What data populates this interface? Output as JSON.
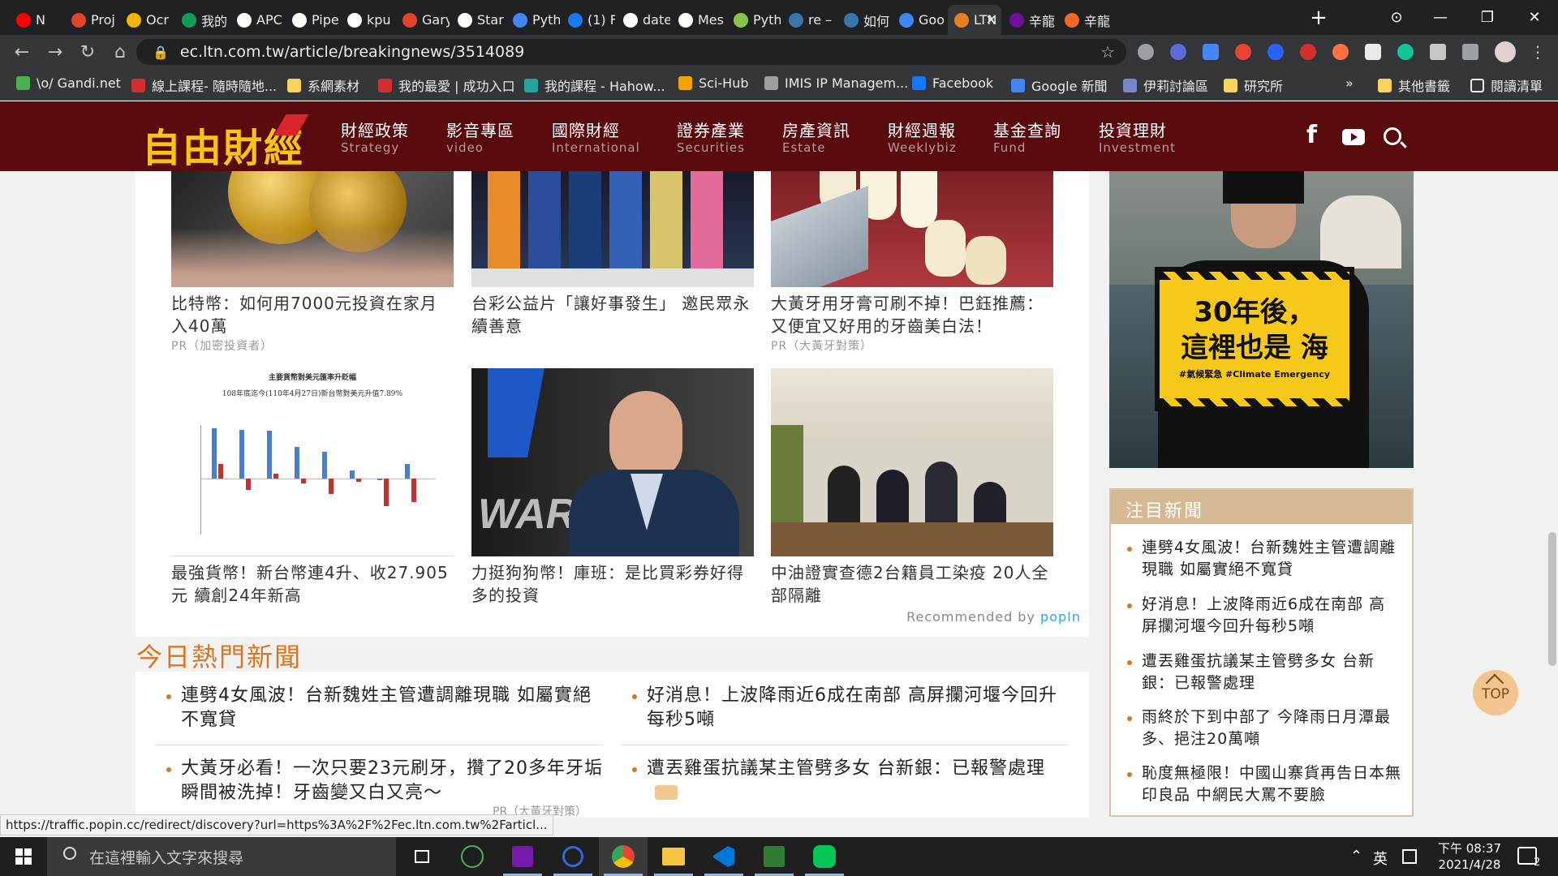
{
  "browser": {
    "tabs": [
      {
        "label": "N",
        "color": "#ff0000"
      },
      {
        "label": "Proj",
        "color": "#e24329"
      },
      {
        "label": "Ocr",
        "color": "#f4b400"
      },
      {
        "label": "我的",
        "color": "#0f9d58"
      },
      {
        "label": "APC",
        "color": "#ffffff"
      },
      {
        "label": "Pipe",
        "color": "#ffffff"
      },
      {
        "label": "kpu",
        "color": "#ffffff"
      },
      {
        "label": "Gary",
        "color": "#e24329"
      },
      {
        "label": "Star",
        "color": "#ffffff"
      },
      {
        "label": "Pyth",
        "color": "#4285f4"
      },
      {
        "label": "(1) F",
        "color": "#1877f2"
      },
      {
        "label": "date",
        "color": "#ffffff"
      },
      {
        "label": "Mes",
        "color": "#ffffff"
      },
      {
        "label": "Pyth",
        "color": "#8bc34a"
      },
      {
        "label": "re –",
        "color": "#3776ab"
      },
      {
        "label": "如何",
        "color": "#3776ab"
      },
      {
        "label": "Goo",
        "color": "#4285f4"
      },
      {
        "label": "LTN i",
        "color": "#e67e22"
      },
      {
        "label": "辛龍",
        "color": "#720e9e"
      },
      {
        "label": "辛龍",
        "color": "#f26722"
      }
    ],
    "url": "ec.ltn.com.tw/article/breakingnews/3514089",
    "bookmarks": [
      {
        "label": "\\o/ Gandi.net",
        "color": "#4caf50"
      },
      {
        "label": "線上課程- 隨時隨地...",
        "color": "#d32f2f"
      },
      {
        "label": "系網素材",
        "color": "#f9d35c"
      },
      {
        "label": "我的最愛 | 成功入口",
        "color": "#d32f2f"
      },
      {
        "label": "我的課程 - Hahow...",
        "color": "#26a69a"
      },
      {
        "label": "Sci-Hub",
        "color": "#f4a300"
      },
      {
        "label": "IMIS IP Managem...",
        "color": "#9e9e9e"
      },
      {
        "label": "Facebook",
        "color": "#1877f2"
      },
      {
        "label": "Google 新聞",
        "color": "#4285f4"
      },
      {
        "label": "伊莉討論區",
        "color": "#7986cb"
      },
      {
        "label": "研究所",
        "color": "#f9d35c"
      }
    ],
    "other_bookmarks": "其他書籤",
    "reading_list": "閱讀清單"
  },
  "site": {
    "logo": "自由財經",
    "nav": [
      {
        "zh": "財經政策",
        "en": "Strategy"
      },
      {
        "zh": "影音專區",
        "en": "video"
      },
      {
        "zh": "國際財經",
        "en": "International"
      },
      {
        "zh": "證券產業",
        "en": "Securities"
      },
      {
        "zh": "房產資訊",
        "en": "Estate"
      },
      {
        "zh": "財經週報",
        "en": "Weeklybiz"
      },
      {
        "zh": "基金查詢",
        "en": "Fund"
      },
      {
        "zh": "投資理財",
        "en": "Investment"
      }
    ]
  },
  "recommend": {
    "cards": [
      {
        "title": "比特幣：如何用7000元投資在家月入40萬",
        "source": "PR（加密投資者）"
      },
      {
        "title": "台彩公益片「讓好事發生」 邀民眾永續善意",
        "source": ""
      },
      {
        "title": "大黃牙用牙膏可刷不掉！巴鈺推薦：又便宜又好用的牙齒美白法！",
        "source": "PR（大黃牙對策）"
      },
      {
        "title": "最強貨幣！新台幣連4升、收27.905元 續創24年新高",
        "source": "",
        "chart_caption": "主要貨幣對美元匯率升貶幅",
        "chart_sub": "108年底迄今(110年4月27日)新台幣對美元升值7.89%"
      },
      {
        "title": "力挺狗狗幣！庫班：是比買彩券好得多的投資",
        "source": ""
      },
      {
        "title": "中油證實查德2台籍員工染疫 20人全部隔離",
        "source": ""
      }
    ],
    "recommended_by": "Recommended by",
    "brand": "popIn"
  },
  "hot_news": {
    "heading": "今日熱門新聞",
    "items": [
      {
        "title": "連劈4女風波！台新魏姓主管遭調離現職 如屬實絕不寬貸",
        "source": ""
      },
      {
        "title": "好消息！上波降雨近6成在南部 高屏攔河堰今回升每秒5噸",
        "source": ""
      },
      {
        "title": "大黃牙必看！一次只要23元刷牙，攢了20多年牙垢瞬間被洗掉！牙齒變又白又亮～",
        "source": "PR（大黃牙對策）"
      },
      {
        "title": "遭丟雞蛋抗議某主管劈多女 台新銀：已報警處理",
        "source": ""
      }
    ]
  },
  "sidebar": {
    "ad": {
      "headline": "30年後，",
      "headline2": "這裡也是 海",
      "tags": "#氣候緊急 #Climate Emergency"
    },
    "attention_heading": "注目新聞",
    "attention_items": [
      "連劈4女風波！台新魏姓主管遭調離現職 如屬實絕不寬貸",
      "好消息！上波降雨近6成在南部 高屏攔河堰今回升每秒5噸",
      "遭丟雞蛋抗議某主管劈多女 台新銀：已報警處理",
      "雨終於下到中部了 今降雨日月潭最多、挹注20萬噸",
      "恥度無極限！中國山寨貨再告日本無印良品 中網民大罵不要臉"
    ],
    "top_label": "TOP"
  },
  "status_url": "https://traffic.popin.cc/redirect/discovery?url=https%3A%2F%2Fec.ltn.com.tw%2Farticl...",
  "taskbar": {
    "search_placeholder": "在這裡輸入文字來搜尋",
    "ime": "英",
    "time": "下午 08:37",
    "date": "2021/4/28",
    "notif_count": "2"
  }
}
